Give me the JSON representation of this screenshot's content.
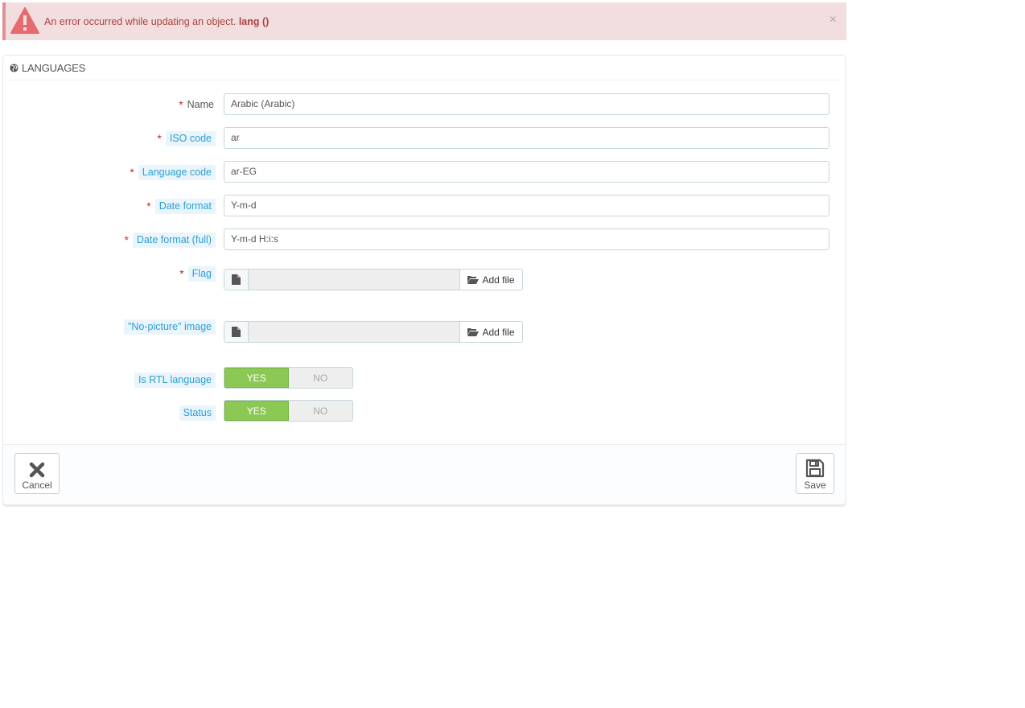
{
  "alert": {
    "message": "An error occurred while updating an object.",
    "message_bold": "lang ()",
    "close_glyph": "×",
    "icon": "warning-icon",
    "color": "#a94442"
  },
  "panel": {
    "icon": "globe-icon",
    "title": "LANGUAGES"
  },
  "form": {
    "required_mark": "*",
    "name": {
      "label": "Name",
      "value": "Arabic (Arabic)"
    },
    "iso_code": {
      "label": "ISO code",
      "value": "ar"
    },
    "language_code": {
      "label": "Language code",
      "value": "ar-EG"
    },
    "date_format": {
      "label": "Date format",
      "value": "Y-m-d"
    },
    "date_format_full": {
      "label": "Date format (full)",
      "value": "Y-m-d H:i:s"
    },
    "flag": {
      "label": "Flag",
      "button": "Add file"
    },
    "no_picture": {
      "label": "\"No-picture\" image",
      "button": "Add file"
    },
    "is_rtl": {
      "label": "Is RTL language",
      "yes": "YES",
      "no": "NO",
      "selected": "YES"
    },
    "status": {
      "label": "Status",
      "yes": "YES",
      "no": "NO",
      "selected": "YES"
    }
  },
  "footer": {
    "cancel_label": "Cancel",
    "save_label": "Save"
  },
  "colors": {
    "accent": "#2c9ed4",
    "switch_on": "#8bc954",
    "required": "#c12d2d"
  }
}
